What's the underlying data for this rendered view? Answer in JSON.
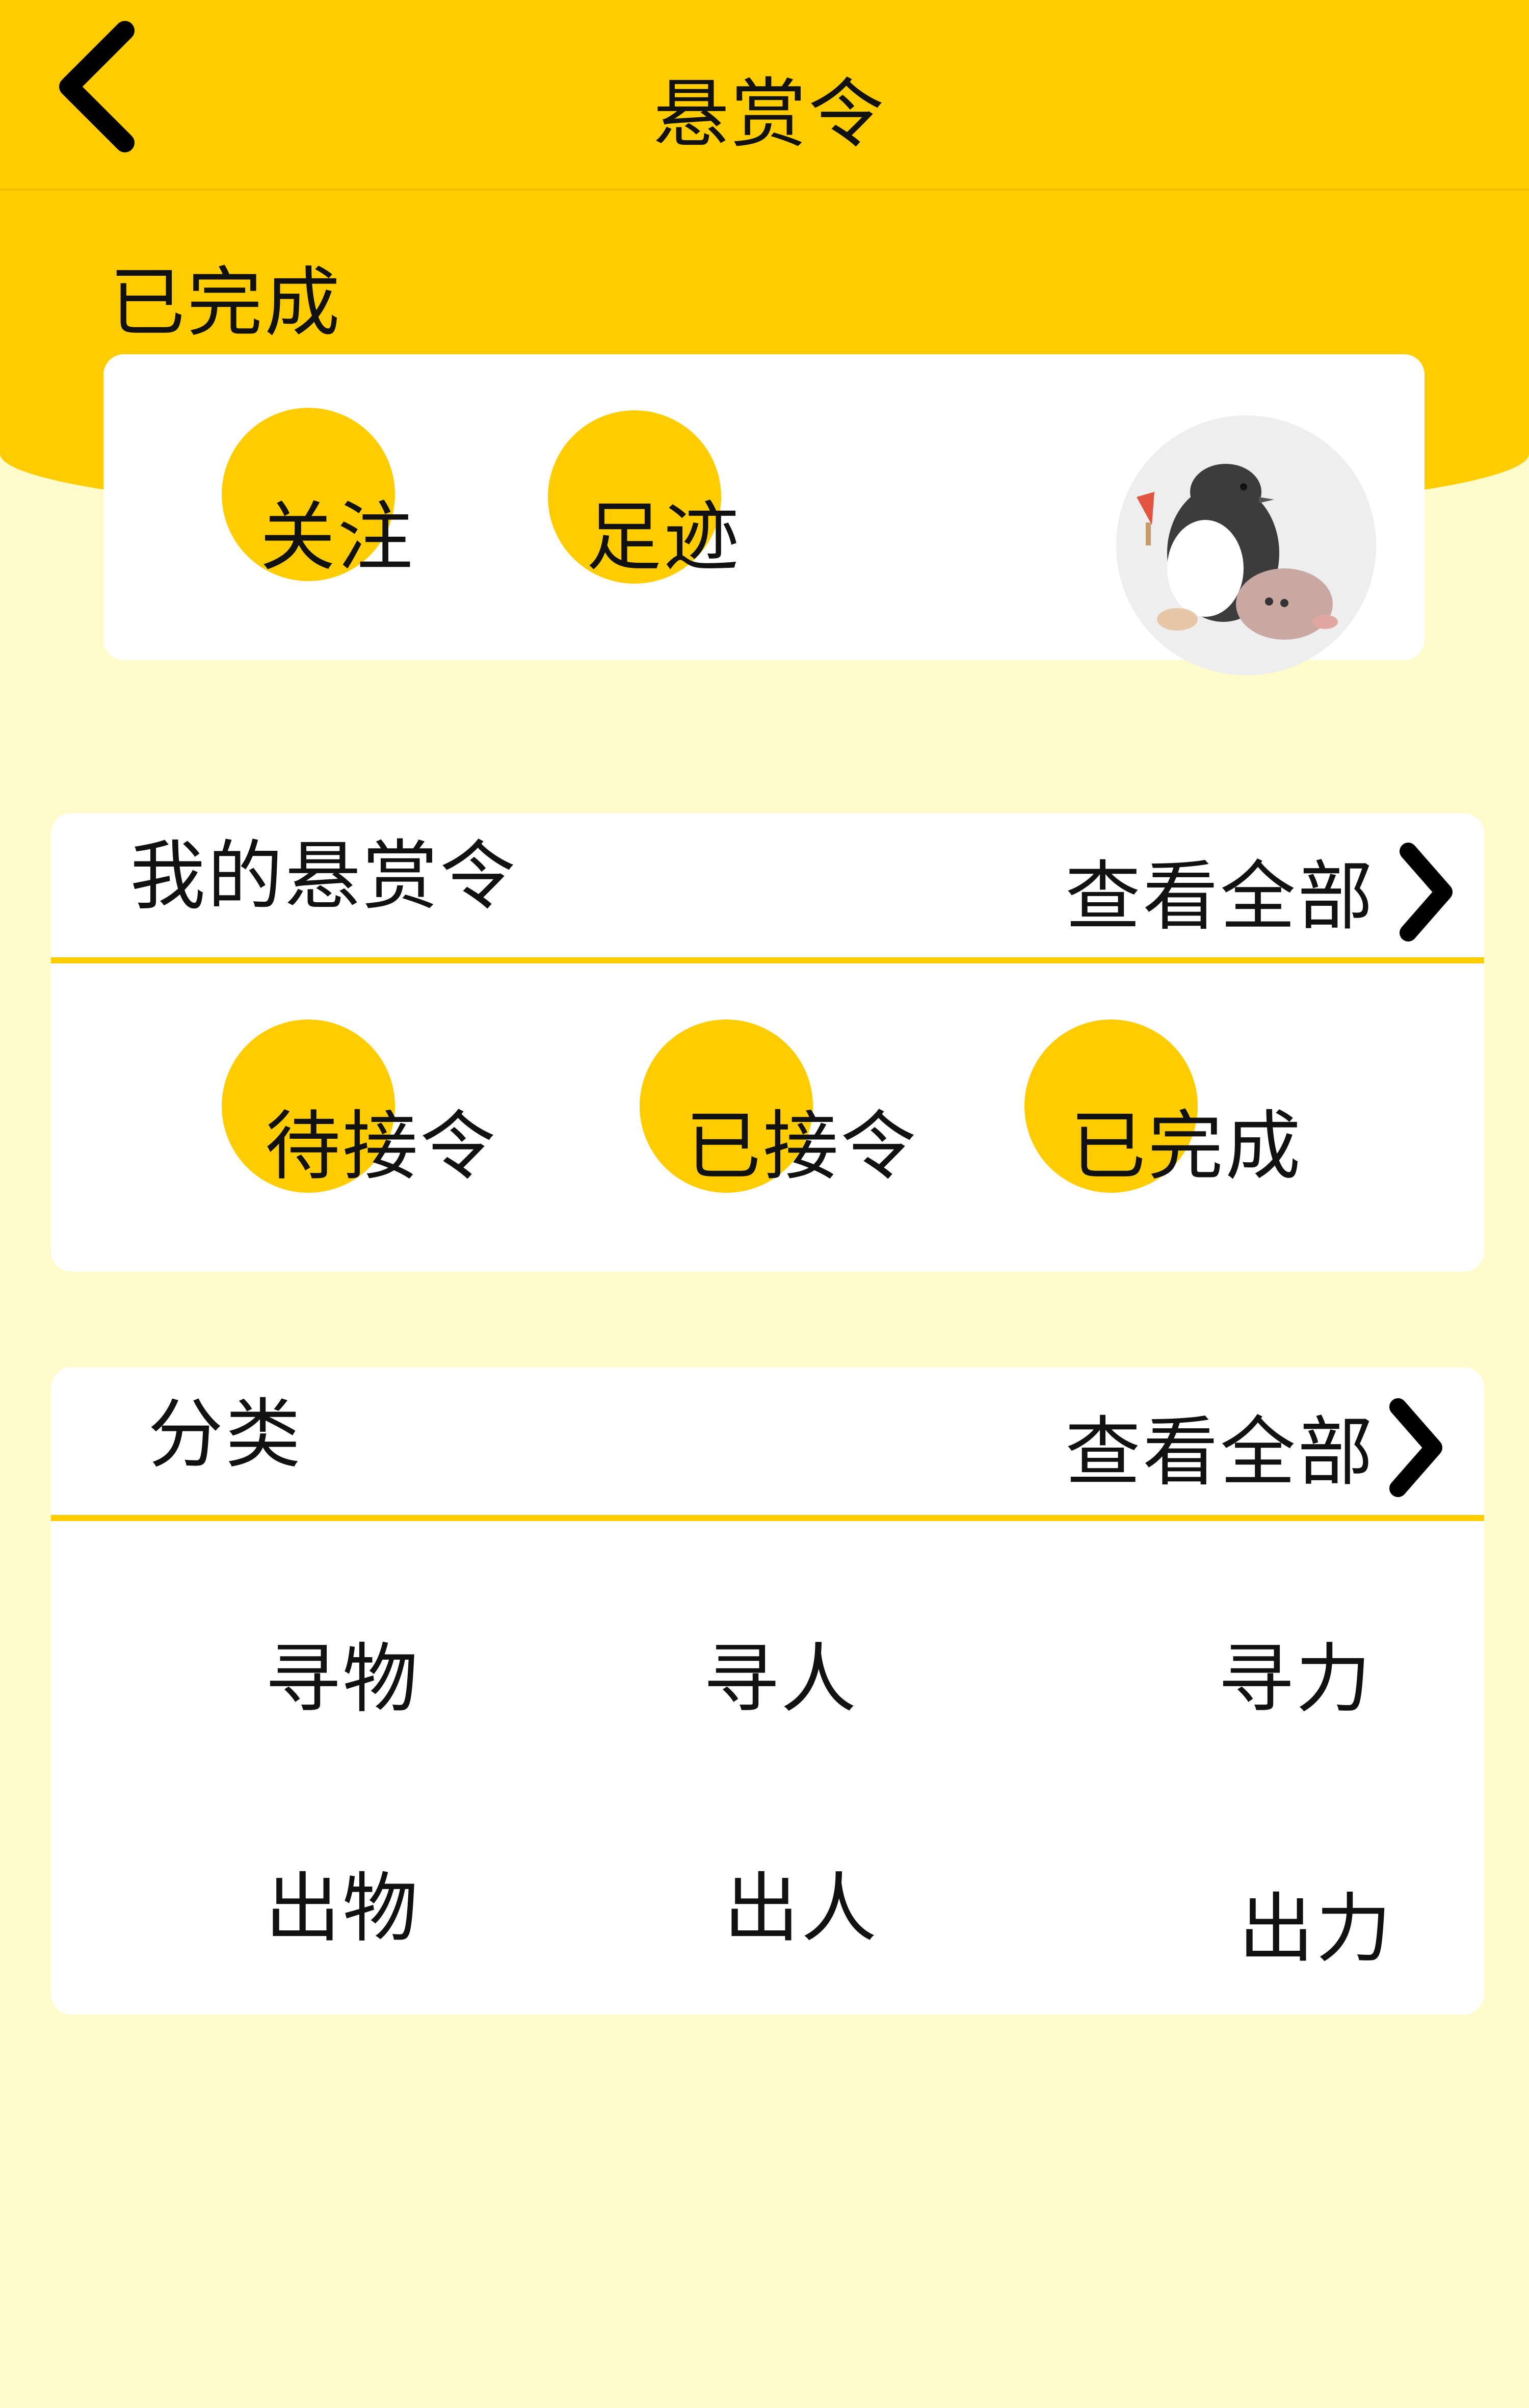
{
  "header": {
    "title": "悬赏令",
    "status": "已完成"
  },
  "profile": {
    "follow_label": "关注",
    "footprint_label": "足迹",
    "avatar": "avatar-penguin-illustration"
  },
  "my_bounty": {
    "title": "我的悬赏令",
    "view_all": "查看全部",
    "tabs": [
      {
        "label": "待接令"
      },
      {
        "label": "已接令"
      },
      {
        "label": "已完成"
      }
    ]
  },
  "category": {
    "title": "分类",
    "view_all": "查看全部",
    "items": [
      {
        "label": "寻物"
      },
      {
        "label": "寻人"
      },
      {
        "label": "寻力"
      },
      {
        "label": "出物"
      },
      {
        "label": "出人"
      },
      {
        "label": "出力"
      }
    ]
  },
  "colors": {
    "accent": "#FFCC00",
    "background": "#FFFBCB",
    "card": "#FFFFFF"
  }
}
